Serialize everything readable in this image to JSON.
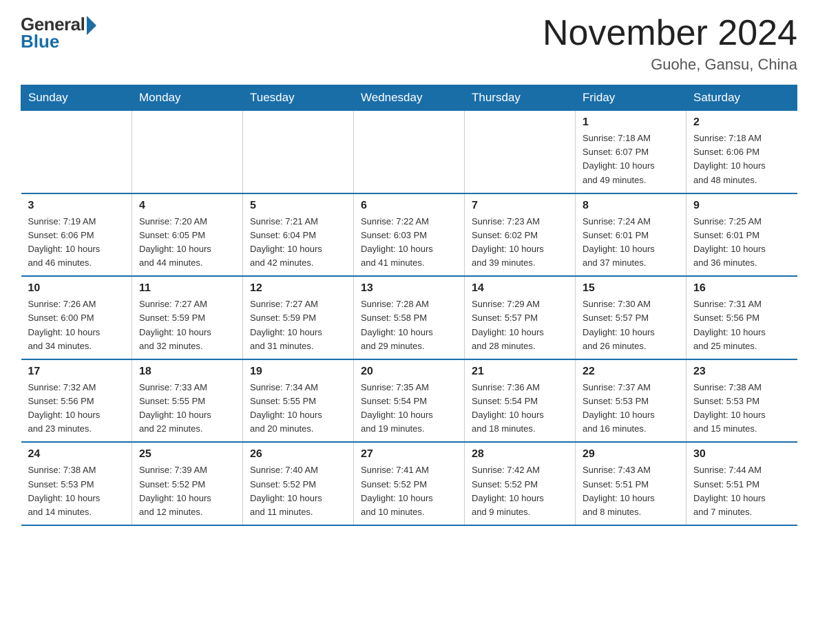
{
  "logo": {
    "general": "General",
    "blue": "Blue"
  },
  "header": {
    "title": "November 2024",
    "subtitle": "Guohe, Gansu, China"
  },
  "weekdays": [
    "Sunday",
    "Monday",
    "Tuesday",
    "Wednesday",
    "Thursday",
    "Friday",
    "Saturday"
  ],
  "weeks": [
    [
      {
        "day": "",
        "info": ""
      },
      {
        "day": "",
        "info": ""
      },
      {
        "day": "",
        "info": ""
      },
      {
        "day": "",
        "info": ""
      },
      {
        "day": "",
        "info": ""
      },
      {
        "day": "1",
        "info": "Sunrise: 7:18 AM\nSunset: 6:07 PM\nDaylight: 10 hours\nand 49 minutes."
      },
      {
        "day": "2",
        "info": "Sunrise: 7:18 AM\nSunset: 6:06 PM\nDaylight: 10 hours\nand 48 minutes."
      }
    ],
    [
      {
        "day": "3",
        "info": "Sunrise: 7:19 AM\nSunset: 6:06 PM\nDaylight: 10 hours\nand 46 minutes."
      },
      {
        "day": "4",
        "info": "Sunrise: 7:20 AM\nSunset: 6:05 PM\nDaylight: 10 hours\nand 44 minutes."
      },
      {
        "day": "5",
        "info": "Sunrise: 7:21 AM\nSunset: 6:04 PM\nDaylight: 10 hours\nand 42 minutes."
      },
      {
        "day": "6",
        "info": "Sunrise: 7:22 AM\nSunset: 6:03 PM\nDaylight: 10 hours\nand 41 minutes."
      },
      {
        "day": "7",
        "info": "Sunrise: 7:23 AM\nSunset: 6:02 PM\nDaylight: 10 hours\nand 39 minutes."
      },
      {
        "day": "8",
        "info": "Sunrise: 7:24 AM\nSunset: 6:01 PM\nDaylight: 10 hours\nand 37 minutes."
      },
      {
        "day": "9",
        "info": "Sunrise: 7:25 AM\nSunset: 6:01 PM\nDaylight: 10 hours\nand 36 minutes."
      }
    ],
    [
      {
        "day": "10",
        "info": "Sunrise: 7:26 AM\nSunset: 6:00 PM\nDaylight: 10 hours\nand 34 minutes."
      },
      {
        "day": "11",
        "info": "Sunrise: 7:27 AM\nSunset: 5:59 PM\nDaylight: 10 hours\nand 32 minutes."
      },
      {
        "day": "12",
        "info": "Sunrise: 7:27 AM\nSunset: 5:59 PM\nDaylight: 10 hours\nand 31 minutes."
      },
      {
        "day": "13",
        "info": "Sunrise: 7:28 AM\nSunset: 5:58 PM\nDaylight: 10 hours\nand 29 minutes."
      },
      {
        "day": "14",
        "info": "Sunrise: 7:29 AM\nSunset: 5:57 PM\nDaylight: 10 hours\nand 28 minutes."
      },
      {
        "day": "15",
        "info": "Sunrise: 7:30 AM\nSunset: 5:57 PM\nDaylight: 10 hours\nand 26 minutes."
      },
      {
        "day": "16",
        "info": "Sunrise: 7:31 AM\nSunset: 5:56 PM\nDaylight: 10 hours\nand 25 minutes."
      }
    ],
    [
      {
        "day": "17",
        "info": "Sunrise: 7:32 AM\nSunset: 5:56 PM\nDaylight: 10 hours\nand 23 minutes."
      },
      {
        "day": "18",
        "info": "Sunrise: 7:33 AM\nSunset: 5:55 PM\nDaylight: 10 hours\nand 22 minutes."
      },
      {
        "day": "19",
        "info": "Sunrise: 7:34 AM\nSunset: 5:55 PM\nDaylight: 10 hours\nand 20 minutes."
      },
      {
        "day": "20",
        "info": "Sunrise: 7:35 AM\nSunset: 5:54 PM\nDaylight: 10 hours\nand 19 minutes."
      },
      {
        "day": "21",
        "info": "Sunrise: 7:36 AM\nSunset: 5:54 PM\nDaylight: 10 hours\nand 18 minutes."
      },
      {
        "day": "22",
        "info": "Sunrise: 7:37 AM\nSunset: 5:53 PM\nDaylight: 10 hours\nand 16 minutes."
      },
      {
        "day": "23",
        "info": "Sunrise: 7:38 AM\nSunset: 5:53 PM\nDaylight: 10 hours\nand 15 minutes."
      }
    ],
    [
      {
        "day": "24",
        "info": "Sunrise: 7:38 AM\nSunset: 5:53 PM\nDaylight: 10 hours\nand 14 minutes."
      },
      {
        "day": "25",
        "info": "Sunrise: 7:39 AM\nSunset: 5:52 PM\nDaylight: 10 hours\nand 12 minutes."
      },
      {
        "day": "26",
        "info": "Sunrise: 7:40 AM\nSunset: 5:52 PM\nDaylight: 10 hours\nand 11 minutes."
      },
      {
        "day": "27",
        "info": "Sunrise: 7:41 AM\nSunset: 5:52 PM\nDaylight: 10 hours\nand 10 minutes."
      },
      {
        "day": "28",
        "info": "Sunrise: 7:42 AM\nSunset: 5:52 PM\nDaylight: 10 hours\nand 9 minutes."
      },
      {
        "day": "29",
        "info": "Sunrise: 7:43 AM\nSunset: 5:51 PM\nDaylight: 10 hours\nand 8 minutes."
      },
      {
        "day": "30",
        "info": "Sunrise: 7:44 AM\nSunset: 5:51 PM\nDaylight: 10 hours\nand 7 minutes."
      }
    ]
  ]
}
